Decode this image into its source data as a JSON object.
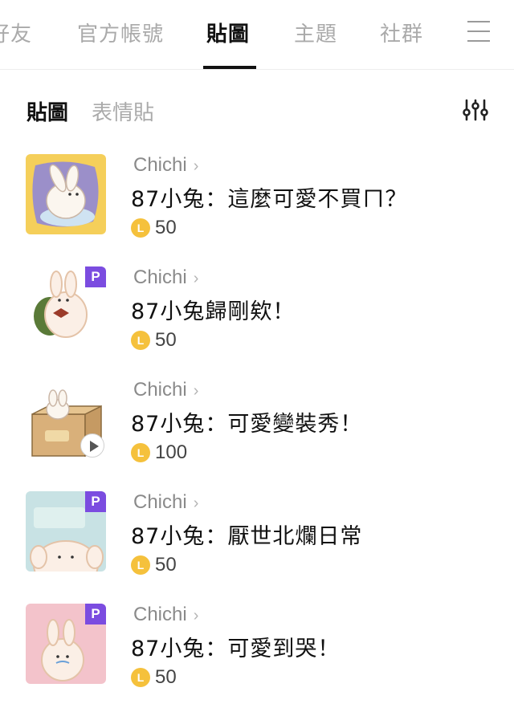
{
  "top_tabs": [
    {
      "label": "好友"
    },
    {
      "label": "官方帳號"
    },
    {
      "label": "貼圖"
    },
    {
      "label": "主題"
    },
    {
      "label": "社群"
    }
  ],
  "sub_tabs": [
    {
      "label": "貼圖"
    },
    {
      "label": "表情貼"
    }
  ],
  "currency_icon_letter": "L",
  "premium_badge": "P",
  "items": [
    {
      "author": "Chichi",
      "title": "87小兔：這麼可愛不買ㄇ？",
      "price": "50",
      "premium": false,
      "animated": false
    },
    {
      "author": "Chichi",
      "title": "87小兔歸剛欸！",
      "price": "50",
      "premium": true,
      "animated": false
    },
    {
      "author": "Chichi",
      "title": "87小兔：可愛變裝秀！",
      "price": "100",
      "premium": false,
      "animated": true
    },
    {
      "author": "Chichi",
      "title": "87小兔：厭世北爛日常",
      "price": "50",
      "premium": true,
      "animated": false
    },
    {
      "author": "Chichi",
      "title": "87小兔：可愛到哭！",
      "price": "50",
      "premium": true,
      "animated": false
    }
  ],
  "colors": {
    "active_text": "#111111",
    "inactive_text": "#aaaaaa",
    "premium": "#7b4ce0",
    "coin": "#f5c13c"
  }
}
